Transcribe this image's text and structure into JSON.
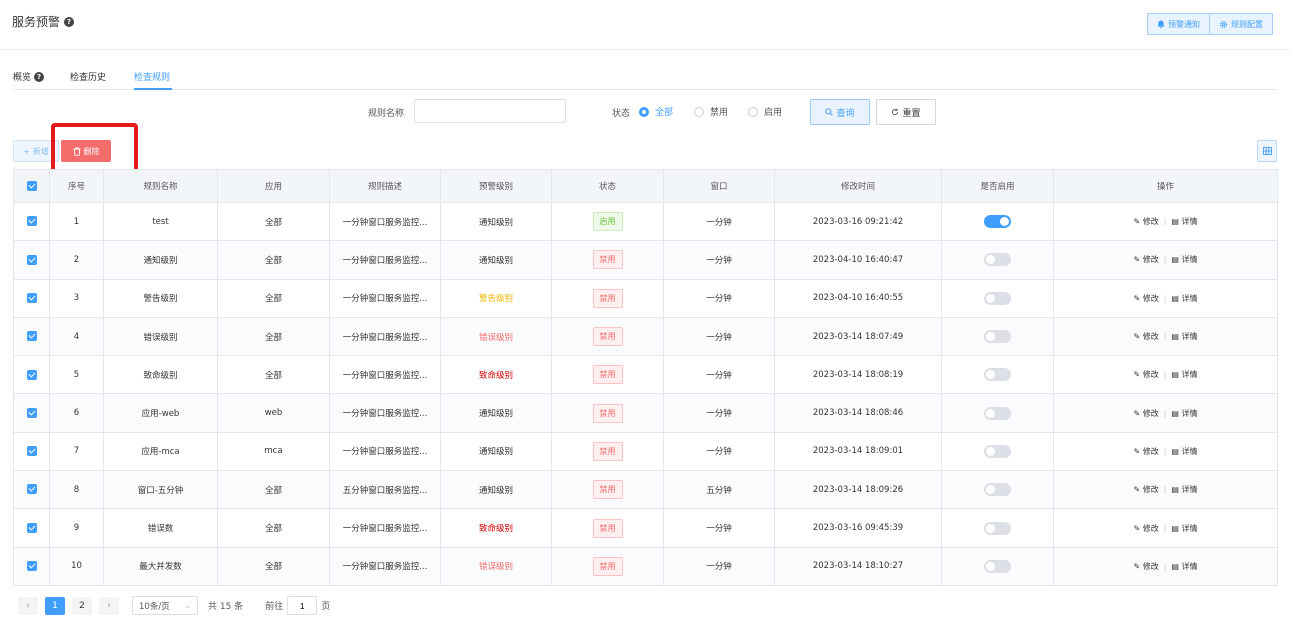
{
  "header": {
    "title": "服务预警",
    "buttons": [
      {
        "icon": "bell-icon",
        "label": "预警通知"
      },
      {
        "icon": "gear-icon",
        "label": "规则配置"
      }
    ]
  },
  "tabs": [
    {
      "label": "概览",
      "has_help": true,
      "active": false
    },
    {
      "label": "检查历史",
      "has_help": false,
      "active": false
    },
    {
      "label": "检查规则",
      "has_help": false,
      "active": true
    }
  ],
  "search": {
    "rule_name_label": "规则名称",
    "rule_name_value": "",
    "rule_name_placeholder": "",
    "status_label": "状态",
    "status_options": [
      "全部",
      "禁用",
      "启用"
    ],
    "status_selected": "全部",
    "query_label": "查询",
    "reset_label": "重置"
  },
  "toolbar": {
    "add_label": "新增",
    "delete_label": "删除"
  },
  "table": {
    "columns": [
      "序号",
      "规则名称",
      "应用",
      "规则描述",
      "预警级别",
      "状态",
      "窗口",
      "修改时间",
      "是否启用",
      "操作"
    ],
    "edit_label": "修改",
    "detail_label": "详情",
    "rows": [
      {
        "no": "1",
        "name": "test",
        "app": "全部",
        "desc": "一分钟窗口服务监控...",
        "level": "通知级别",
        "level_color": "#333333",
        "status": "启用",
        "status_on": true,
        "window": "一分钟",
        "time": "2023-03-16 09:21:42",
        "enabled": true
      },
      {
        "no": "2",
        "name": "通知级别",
        "app": "全部",
        "desc": "一分钟窗口服务监控...",
        "level": "通知级别",
        "level_color": "#333333",
        "status": "禁用",
        "status_on": false,
        "window": "一分钟",
        "time": "2023-04-10 16:40:47",
        "enabled": false
      },
      {
        "no": "3",
        "name": "警告级别",
        "app": "全部",
        "desc": "一分钟窗口服务监控...",
        "level": "警告级别",
        "level_color": "#f5b400",
        "status": "禁用",
        "status_on": false,
        "window": "一分钟",
        "time": "2023-04-10 16:40:55",
        "enabled": false
      },
      {
        "no": "4",
        "name": "错误级别",
        "app": "全部",
        "desc": "一分钟窗口服务监控...",
        "level": "错误级别",
        "level_color": "#f56c6c",
        "status": "禁用",
        "status_on": false,
        "window": "一分钟",
        "time": "2023-03-14 18:07:49",
        "enabled": false
      },
      {
        "no": "5",
        "name": "致命级别",
        "app": "全部",
        "desc": "一分钟窗口服务监控...",
        "level": "致命级别",
        "level_color": "#d40000",
        "status": "禁用",
        "status_on": false,
        "window": "一分钟",
        "time": "2023-03-14 18:08:19",
        "enabled": false
      },
      {
        "no": "6",
        "name": "应用-web",
        "app": "web",
        "desc": "一分钟窗口服务监控...",
        "level": "通知级别",
        "level_color": "#333333",
        "status": "禁用",
        "status_on": false,
        "window": "一分钟",
        "time": "2023-03-14 18:08:46",
        "enabled": false
      },
      {
        "no": "7",
        "name": "应用-mca",
        "app": "mca",
        "desc": "一分钟窗口服务监控...",
        "level": "通知级别",
        "level_color": "#333333",
        "status": "禁用",
        "status_on": false,
        "window": "一分钟",
        "time": "2023-03-14 18:09:01",
        "enabled": false
      },
      {
        "no": "8",
        "name": "窗口-五分钟",
        "app": "全部",
        "desc": "五分钟窗口服务监控...",
        "level": "通知级别",
        "level_color": "#333333",
        "status": "禁用",
        "status_on": false,
        "window": "五分钟",
        "time": "2023-03-14 18:09:26",
        "enabled": false
      },
      {
        "no": "9",
        "name": "错误数",
        "app": "全部",
        "desc": "一分钟窗口服务监控...",
        "level": "致命级别",
        "level_color": "#d40000",
        "status": "禁用",
        "status_on": false,
        "window": "一分钟",
        "time": "2023-03-16 09:45:39",
        "enabled": false
      },
      {
        "no": "10",
        "name": "最大并发数",
        "app": "全部",
        "desc": "一分钟窗口服务监控...",
        "level": "错误级别",
        "level_color": "#f56c6c",
        "status": "禁用",
        "status_on": false,
        "window": "一分钟",
        "time": "2023-03-14 18:10:27",
        "enabled": false
      }
    ]
  },
  "pagination": {
    "pages": [
      "1",
      "2"
    ],
    "current": "1",
    "page_size": "10条/页",
    "total": "共 15 条",
    "goto_prefix": "前往",
    "goto_value": "1",
    "goto_suffix": "页"
  },
  "colors": {
    "accent": "#409eff",
    "danger": "#f56c6c",
    "highlight": "#e31b1b"
  }
}
